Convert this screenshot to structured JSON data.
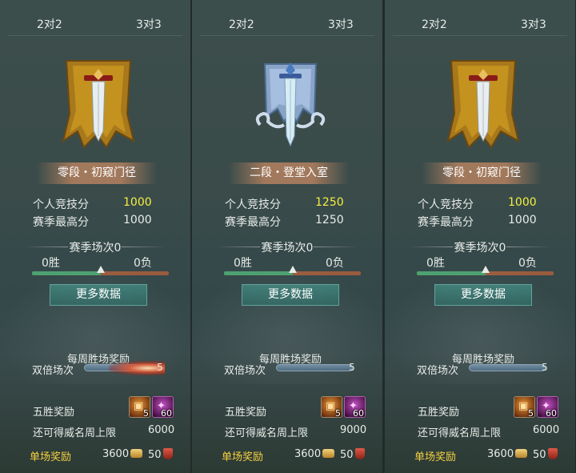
{
  "panels": [
    {
      "tabs": [
        "2对2",
        "3对3"
      ],
      "emblem_icon": "bronze-sword-banner",
      "rank_name": "零段・初窥门径",
      "personal_score_label": "个人竞技分",
      "personal_score": "1000",
      "season_high_label": "赛季最高分",
      "season_high": "1000",
      "season_matches": "赛季场次0",
      "wins": "0胜",
      "losses": "0负",
      "progress": 0.5,
      "more_button": "更多数据",
      "weekly_reward_title": "每周胜场奖励",
      "double_label": "双倍场次",
      "double_count": "5",
      "double_fire": true,
      "five_win_label": "五胜奖励",
      "five_win_items": [
        "5",
        "60"
      ],
      "limit_label": "还可得威名周上限",
      "limit_value": "6000",
      "single_label": "单场奖励",
      "single_coin": "3600",
      "single_shield": "50"
    },
    {
      "tabs": [
        "2对2",
        "3对3"
      ],
      "emblem_icon": "silver-sword-banner",
      "rank_name": "二段・登堂入室",
      "personal_score_label": "个人竞技分",
      "personal_score": "1250",
      "season_high_label": "赛季最高分",
      "season_high": "1250",
      "season_matches": "赛季场次0",
      "wins": "0胜",
      "losses": "0负",
      "progress": 0.5,
      "more_button": "更多数据",
      "weekly_reward_title": "每周胜场奖励",
      "double_label": "双倍场次",
      "double_count": "5",
      "double_fire": false,
      "five_win_label": "五胜奖励",
      "five_win_items": [
        "5",
        "60"
      ],
      "limit_label": "还可得威名周上限",
      "limit_value": "9000",
      "single_label": "单场奖励",
      "single_coin": "3600",
      "single_shield": "50"
    },
    {
      "tabs": [
        "2对2",
        "3对3"
      ],
      "emblem_icon": "bronze-sword-banner",
      "rank_name": "零段・初窥门径",
      "personal_score_label": "个人竞技分",
      "personal_score": "1000",
      "season_high_label": "赛季最高分",
      "season_high": "1000",
      "season_matches": "赛季场次0",
      "wins": "0胜",
      "losses": "0负",
      "progress": 0.5,
      "more_button": "更多数据",
      "weekly_reward_title": "每周胜场奖励",
      "double_label": "双倍场次",
      "double_count": "5",
      "double_fire": false,
      "five_win_label": "五胜奖励",
      "five_win_items": [
        "5",
        "60"
      ],
      "limit_label": "还可得威名周上限",
      "limit_value": "6000",
      "single_label": "单场奖励",
      "single_coin": "3600",
      "single_shield": "50"
    }
  ],
  "colors": {
    "highlight_score": "#f4f040",
    "single_reward_label": "#f4d040",
    "progress_win": "#4da070",
    "progress_loss": "#9a5c3e",
    "button": "#2d605c"
  }
}
